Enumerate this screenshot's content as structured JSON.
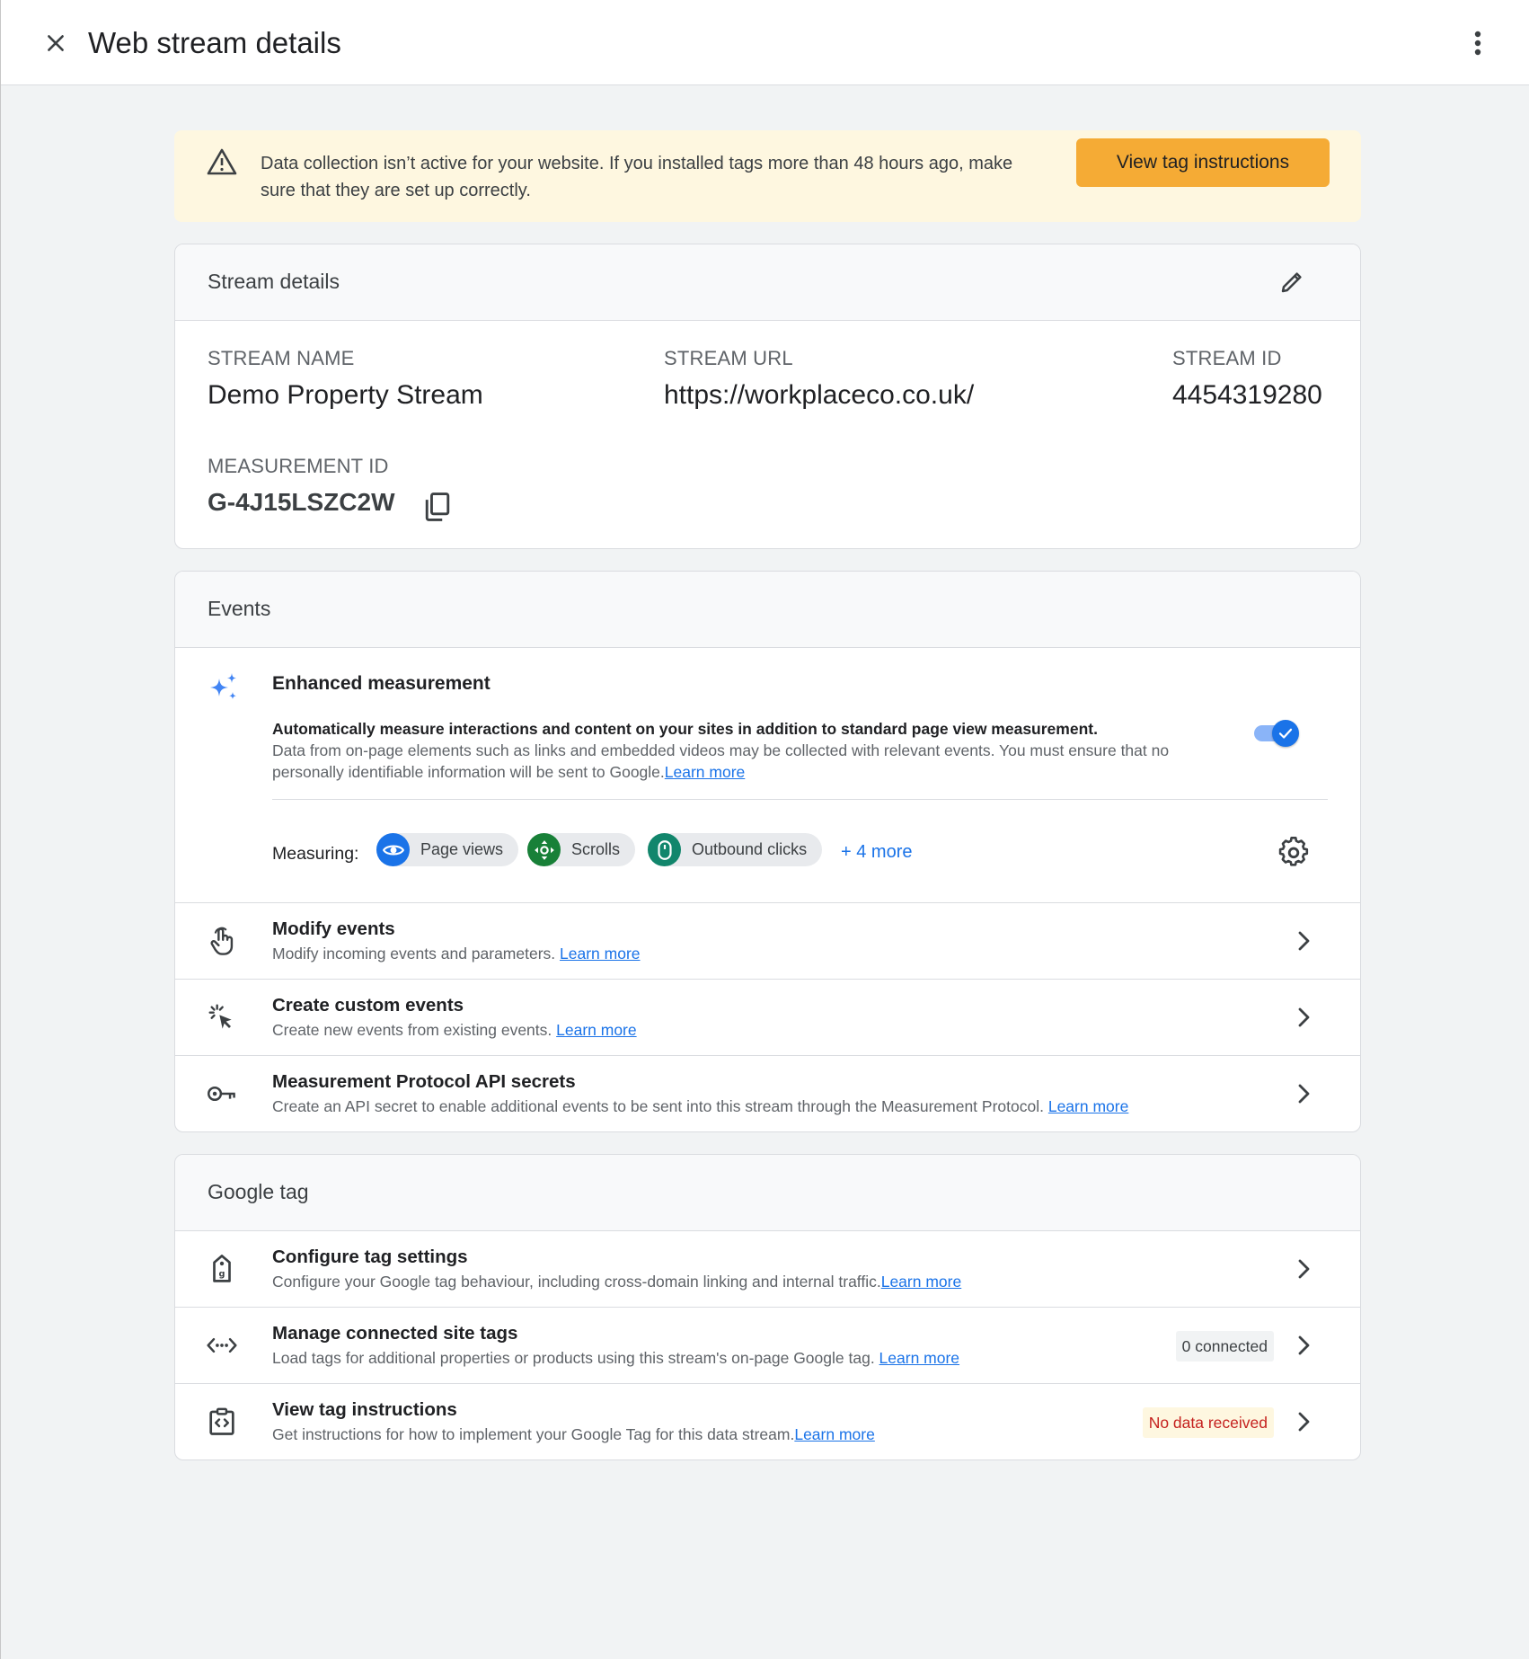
{
  "header": {
    "title": "Web stream details",
    "close_icon": "close-icon",
    "more_icon": "more-vert-icon"
  },
  "banner": {
    "icon": "warning-icon",
    "text": "Data collection isn’t active for your website. If you installed tags more than 48 hours ago, make sure that they are set up correctly.",
    "button_label": "View tag instructions",
    "button_color": "#f5ab35",
    "background": "#fef7e0"
  },
  "stream_details": {
    "title": "Stream details",
    "stream_name_label": "STREAM NAME",
    "stream_name": "Demo Property Stream",
    "stream_url_label": "STREAM URL",
    "stream_url": "https://workplaceco.co.uk/",
    "stream_id_label": "STREAM ID",
    "stream_id": "4454319280",
    "measurement_id_label": "MEASUREMENT ID",
    "measurement_id": "G-4J15LSZC2W"
  },
  "events": {
    "title": "Events",
    "enhanced": {
      "title": "Enhanced measurement",
      "desc_bold": "Automatically measure interactions and content on your sites in addition to standard page view measurement.",
      "desc": "Data from on-page elements such as links and embedded videos may be collected with relevant events. You must ensure that no personally identifiable information will be sent to Google.",
      "learn_more": "Learn more",
      "toggle_on": true,
      "measuring_label": "Measuring:",
      "chips": [
        {
          "label": "Page views",
          "icon": "eye-icon",
          "color": "#1a73e8"
        },
        {
          "label": "Scrolls",
          "icon": "scroll-icon",
          "color": "#188038"
        },
        {
          "label": "Outbound clicks",
          "icon": "mouse-icon",
          "color": "#12866c"
        }
      ],
      "more_label": "+ 4 more"
    },
    "rows": [
      {
        "title": "Modify events",
        "subtitle": "Modify incoming events and parameters. ",
        "link": "Learn more",
        "icon": "touch-icon"
      },
      {
        "title": "Create custom events",
        "subtitle": "Create new events from existing events. ",
        "link": "Learn more",
        "icon": "click-icon"
      },
      {
        "title": "Measurement Protocol API secrets",
        "subtitle": "Create an API secret to enable additional events to be sent into this stream through the Measurement Protocol. ",
        "link": "Learn more",
        "icon": "key-icon"
      }
    ]
  },
  "google_tag": {
    "title": "Google tag",
    "rows": [
      {
        "title": "Configure tag settings",
        "subtitle": "Configure your Google tag behaviour, including cross-domain linking and internal traffic.",
        "link": "Learn more",
        "icon": "tag-icon"
      },
      {
        "title": "Manage connected site tags",
        "subtitle": "Load tags for additional properties or products using this stream's on-page Google tag. ",
        "link": "Learn more",
        "icon": "code-arrows-icon",
        "badge": "0 connected"
      },
      {
        "title": "View tag instructions",
        "subtitle": "Get instructions for how to implement your Google Tag for this data stream.",
        "link": "Learn more",
        "icon": "code-clipboard-icon",
        "badge": "No data received"
      }
    ]
  }
}
